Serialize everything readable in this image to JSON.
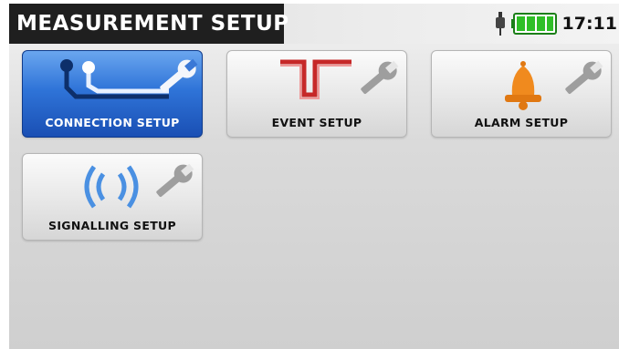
{
  "header": {
    "title": "MEASUREMENT SETUP",
    "time": "17:11"
  },
  "tiles": [
    {
      "label": "CONNECTION SETUP",
      "active": true
    },
    {
      "label": "EVENT SETUP",
      "active": false
    },
    {
      "label": "ALARM SETUP",
      "active": false
    },
    {
      "label": "SIGNALLING SETUP",
      "active": false
    }
  ],
  "icons": {
    "plug": "plug-icon",
    "battery": "battery-icon",
    "wrench": "wrench-icon",
    "connection": "connection-diagram-icon",
    "event": "event-dip-icon",
    "alarm": "bell-icon",
    "signal": "signal-waves-icon"
  },
  "colors": {
    "active_tile": "#2f74d8",
    "battery": "#22a81e",
    "event_line": "#c62828",
    "bell": "#f08a1e",
    "signal_waves": "#4a90e2"
  }
}
